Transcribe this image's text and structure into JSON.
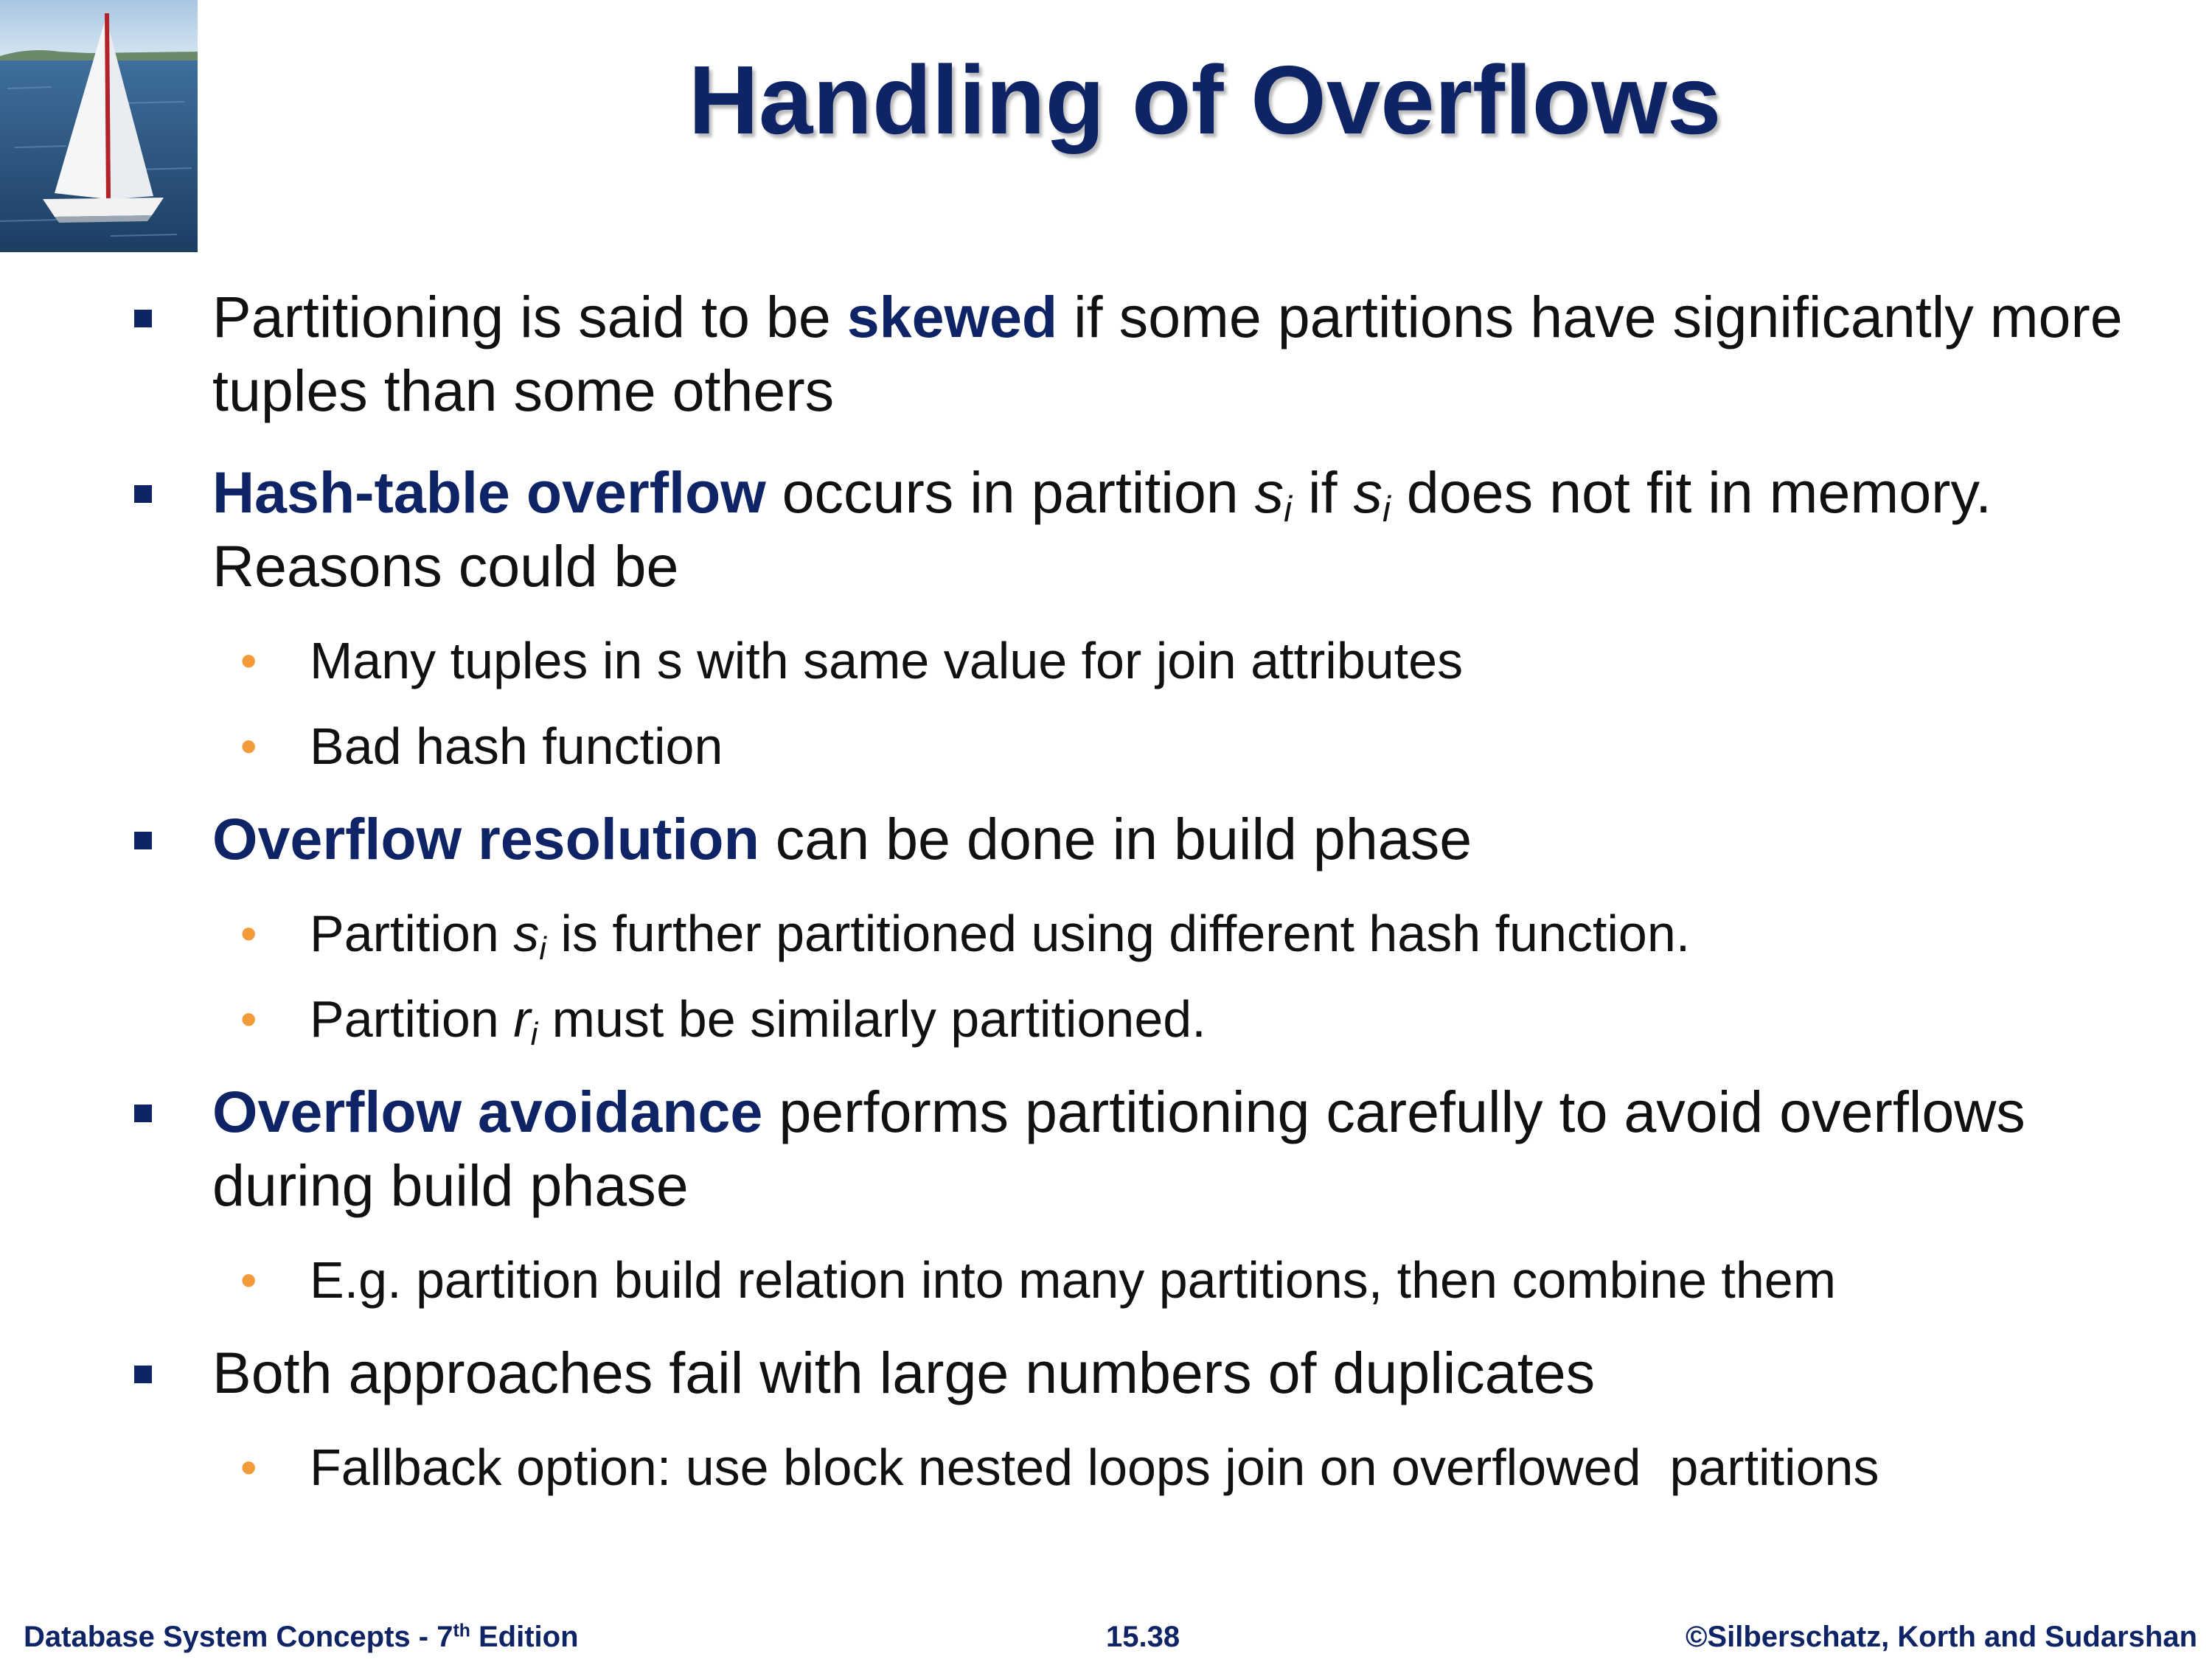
{
  "title": "Handling of Overflows",
  "bullets": {
    "b1": {
      "pre": "Partitioning is said to be ",
      "kw": "skewed",
      "post": " if some partitions have significantly more tuples than some others"
    },
    "b2": {
      "kw": "Hash-table overflow",
      "t1": " occurs in partition ",
      "s": "s",
      "sub1": "i",
      "t2": " if ",
      "s2": "s",
      "sub2": "i",
      "t3": " does not fit in memory. Reasons could be"
    },
    "b2_sub": [
      "Many tuples in s with same value for join attributes",
      "Bad hash function"
    ],
    "b3": {
      "kw": "Overflow resolution",
      "post": " can be done in build phase"
    },
    "b3_sub1": {
      "pre": "Partition ",
      "var": "s",
      "sub": "i",
      "post": " is further partitioned using different hash function."
    },
    "b3_sub2": {
      "pre": "Partition ",
      "var": "r",
      "sub": "i",
      "post": " must be similarly partitioned."
    },
    "b4": {
      "kw": "Overflow avoidance",
      "post": " performs partitioning carefully to avoid overflows during build phase"
    },
    "b4_sub": "E.g. partition build relation into many partitions, then combine them",
    "b5": "Both approaches fail with large numbers of duplicates",
    "b5_sub": "Fallback option: use block nested loops join on overflowed  partitions"
  },
  "footer": {
    "left_pre": "Database System Concepts - 7",
    "left_sup": "th",
    "left_post": " Edition",
    "center": "15.38",
    "right": "©Silberschatz, Korth and Sudarshan"
  },
  "colors": {
    "title": "#0f2466",
    "keyword": "#0f2466",
    "square_bullet": "#0f2466",
    "dot_bullet": "#f39a3a",
    "footer": "#0f2466"
  },
  "icons": {
    "logo": "sailboat-logo",
    "level1_bullet": "square-bullet-icon",
    "level2_bullet": "dot-bullet-icon"
  }
}
